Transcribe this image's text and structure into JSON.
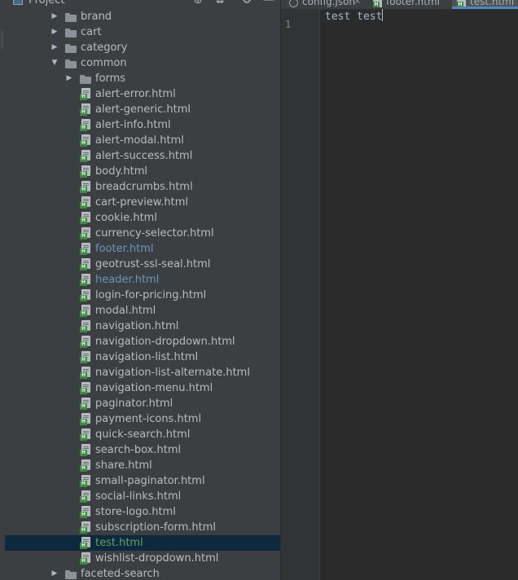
{
  "project_panel": {
    "title": "Project",
    "header_icons": [
      "globe-icon",
      "collapse-all-icon",
      "gear-icon",
      "minimize-icon"
    ]
  },
  "tree": [
    {
      "label": "brand",
      "type": "folder",
      "expanded": false,
      "depth": 2
    },
    {
      "label": "cart",
      "type": "folder",
      "expanded": false,
      "depth": 2
    },
    {
      "label": "category",
      "type": "folder",
      "expanded": false,
      "depth": 2
    },
    {
      "label": "common",
      "type": "folder",
      "expanded": true,
      "depth": 2
    },
    {
      "label": "forms",
      "type": "folder",
      "expanded": false,
      "depth": 3
    },
    {
      "label": "alert-error.html",
      "type": "html",
      "status": "normal",
      "depth": 3
    },
    {
      "label": "alert-generic.html",
      "type": "html",
      "status": "normal",
      "depth": 3
    },
    {
      "label": "alert-info.html",
      "type": "html",
      "status": "normal",
      "depth": 3
    },
    {
      "label": "alert-modal.html",
      "type": "html",
      "status": "normal",
      "depth": 3
    },
    {
      "label": "alert-success.html",
      "type": "html",
      "status": "normal",
      "depth": 3
    },
    {
      "label": "body.html",
      "type": "html",
      "status": "normal",
      "depth": 3
    },
    {
      "label": "breadcrumbs.html",
      "type": "html",
      "status": "normal",
      "depth": 3
    },
    {
      "label": "cart-preview.html",
      "type": "html",
      "status": "normal",
      "depth": 3
    },
    {
      "label": "cookie.html",
      "type": "html",
      "status": "normal",
      "depth": 3
    },
    {
      "label": "currency-selector.html",
      "type": "html",
      "status": "normal",
      "depth": 3
    },
    {
      "label": "footer.html",
      "type": "html",
      "status": "modified",
      "depth": 3
    },
    {
      "label": "geotrust-ssl-seal.html",
      "type": "html",
      "status": "normal",
      "depth": 3
    },
    {
      "label": "header.html",
      "type": "html",
      "status": "modified",
      "depth": 3
    },
    {
      "label": "login-for-pricing.html",
      "type": "html",
      "status": "normal",
      "depth": 3
    },
    {
      "label": "modal.html",
      "type": "html",
      "status": "normal",
      "depth": 3
    },
    {
      "label": "navigation.html",
      "type": "html",
      "status": "normal",
      "depth": 3
    },
    {
      "label": "navigation-dropdown.html",
      "type": "html",
      "status": "normal",
      "depth": 3
    },
    {
      "label": "navigation-list.html",
      "type": "html",
      "status": "normal",
      "depth": 3
    },
    {
      "label": "navigation-list-alternate.html",
      "type": "html",
      "status": "normal",
      "depth": 3
    },
    {
      "label": "navigation-menu.html",
      "type": "html",
      "status": "normal",
      "depth": 3
    },
    {
      "label": "paginator.html",
      "type": "html",
      "status": "normal",
      "depth": 3
    },
    {
      "label": "payment-icons.html",
      "type": "html",
      "status": "normal",
      "depth": 3
    },
    {
      "label": "quick-search.html",
      "type": "html",
      "status": "normal",
      "depth": 3
    },
    {
      "label": "search-box.html",
      "type": "html",
      "status": "normal",
      "depth": 3
    },
    {
      "label": "share.html",
      "type": "html",
      "status": "normal",
      "depth": 3
    },
    {
      "label": "small-paginator.html",
      "type": "html",
      "status": "normal",
      "depth": 3
    },
    {
      "label": "social-links.html",
      "type": "html",
      "status": "normal",
      "depth": 3
    },
    {
      "label": "store-logo.html",
      "type": "html",
      "status": "normal",
      "depth": 3
    },
    {
      "label": "subscription-form.html",
      "type": "html",
      "status": "normal",
      "depth": 3
    },
    {
      "label": "test.html",
      "type": "html",
      "status": "added",
      "selected": true,
      "depth": 3
    },
    {
      "label": "wishlist-dropdown.html",
      "type": "html",
      "status": "normal",
      "depth": 3
    },
    {
      "label": "faceted-search",
      "type": "folder",
      "expanded": false,
      "depth": 2
    }
  ],
  "editor": {
    "tabs": [
      {
        "label": "config.json",
        "icon": "json-file-icon",
        "active": false
      },
      {
        "label": "footer.html",
        "icon": "html-file-icon",
        "active": false
      },
      {
        "label": "test.html",
        "icon": "html-file-icon",
        "active": true
      }
    ],
    "line_number": "1",
    "code": "test test"
  },
  "colors": {
    "panel_bg": "#3c3f41",
    "editor_bg": "#2b2b2b",
    "selection": "#0d293e",
    "modified_file": "#6897bb",
    "added_file": "#62a362",
    "text": "#bbbbbb"
  }
}
